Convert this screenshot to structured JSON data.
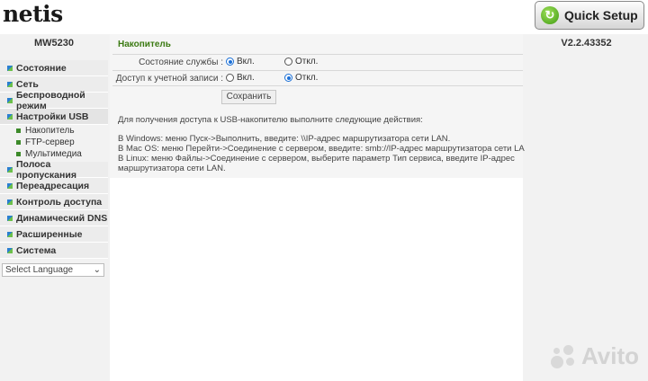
{
  "header": {
    "logo": "netis",
    "quick_setup_label": "Quick Setup",
    "colors": {
      "accent": "#3b7a12",
      "logo_dot": "#7cbf2a"
    }
  },
  "sidebar": {
    "model": "MW5230",
    "items": [
      {
        "label": "Состояние"
      },
      {
        "label": "Сеть"
      },
      {
        "label": "Беспроводной режим"
      },
      {
        "label": "Настройки USB"
      },
      {
        "label": "Полоса пропускания"
      },
      {
        "label": "Переадресация"
      },
      {
        "label": "Контроль доступа"
      },
      {
        "label": "Динамический DNS"
      },
      {
        "label": "Расширенные"
      },
      {
        "label": "Система"
      }
    ],
    "usb_sub_items": [
      {
        "label": "Накопитель"
      },
      {
        "label": "FTP-сервер"
      },
      {
        "label": "Мультимедиа"
      }
    ],
    "language_select": {
      "value": "Select Language",
      "arrow": "⌄"
    }
  },
  "version": "V2.2.43352",
  "main": {
    "title": "Накопитель",
    "rows": [
      {
        "label": "Состояние службы :",
        "on_label": "Вкл.",
        "off_label": "Откл.",
        "selected": "on"
      },
      {
        "label": "Доступ к учетной записи :",
        "on_label": "Вкл.",
        "off_label": "Откл.",
        "selected": "off"
      }
    ],
    "save_label": "Сохранить",
    "info_heading": "Для получения доступа к USB-накопителю выполните следующие действия:",
    "info_lines": [
      " В Windows: меню Пуск->Выполнить, введите: \\\\IP-адрес маршрутизатора сети LAN.",
      "В Mac OS: меню Перейти->Соединение с сервером, введите: smb://IP-адрес маршрутизатора сети LAN.",
      "В Linux: меню Файлы->Соединение с сервером, выберите параметр Тип сервиса, введите IP-адрес",
      "маршрутизатора сети LAN."
    ]
  },
  "watermark": "Avito"
}
